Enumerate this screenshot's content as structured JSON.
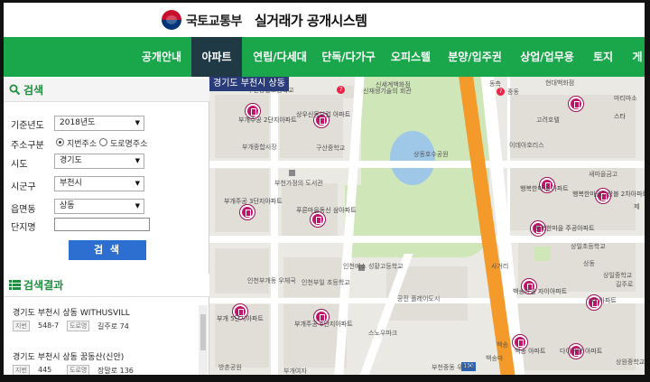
{
  "header": {
    "ministry": "국토교통부",
    "system_name": "실거래가 공개시스템",
    "logo_icon": "taegeuk-logo-icon"
  },
  "nav": {
    "items": [
      {
        "label": "공개안내",
        "active": false
      },
      {
        "label": "아파트",
        "active": true
      },
      {
        "label": "연립/다세대",
        "active": false
      },
      {
        "label": "단독/다가구",
        "active": false
      },
      {
        "label": "오피스텔",
        "active": false
      },
      {
        "label": "분양/입주권",
        "active": false
      },
      {
        "label": "상업/업무용",
        "active": false
      },
      {
        "label": "토지",
        "active": false
      },
      {
        "label": "게",
        "active": false
      }
    ]
  },
  "search": {
    "title": "검색",
    "icon": "search-icon",
    "fields": {
      "year_label": "기준년도",
      "year_value": "2018년도",
      "addr_type_label": "주소구분",
      "addr_options": [
        "지번주소",
        "도로명주소"
      ],
      "addr_selected": "지번주소",
      "sido_label": "시도",
      "sido_value": "경기도",
      "sigungu_label": "시군구",
      "sigungu_value": "부천시",
      "dong_label": "읍면동",
      "dong_value": "상동",
      "complex_label": "단지명",
      "complex_value": ""
    },
    "button": "검 색"
  },
  "results": {
    "title": "검색결과",
    "icon": "list-icon",
    "items": [
      {
        "name": "경기도 부천시 상동 WITHUSVILL",
        "jibun_tag": "지번",
        "jibun": "548-7",
        "road_tag": "도로명",
        "road": "길주로 74"
      },
      {
        "name": "경기도 부천시 상동 꿈동산(신안)",
        "jibun_tag": "지번",
        "jibun": "445",
        "road_tag": "도로명",
        "road": "장말로 136"
      }
    ]
  },
  "map": {
    "region_label": "경기도 부천시 상동",
    "colors": {
      "pin": "#c0136b",
      "park": "#cfe6b8",
      "road_main": "#f39a2b"
    },
    "labels": [
      "부천상일초등학교",
      "신세계백화점",
      "신재생기술의 회관",
      "동측",
      "현대백화점",
      "중동",
      "상동호수공원",
      "고려호텔",
      "이데아호리스",
      "새마을금고",
      "부개종합시장",
      "구산중학교",
      "부천가정의 도서관",
      "인천부일 초등학교",
      "인천예소 성황고등학교",
      "인천부개동 우체국",
      "공진 플레이도시",
      "스노우파크",
      "상일초등학교",
      "방촌공원",
      "부개여자",
      "상동",
      "상일중학교",
      "길주로",
      "사거리",
      "백송",
      "백송마",
      "상원중학교",
      "부천중동 우체국",
      "마티마소"
    ],
    "apartments": [
      "부개주공 2단지아파트",
      "상우신동부럽 아파트",
      "부개주공 3단지아파트",
      "푸른마을동신 삼아파트",
      "부개 5단지아파트",
      "부개주공 6단지아파트",
      "행복한마 을아파트",
      "행복한마을그랑블 2차아파트",
      "행복한마을 주공아파트",
      "LG 아파트",
      "백송마을 자이아파트",
      "백송 아파트",
      "다이아망 아파트",
      "스타",
      "제"
    ]
  }
}
